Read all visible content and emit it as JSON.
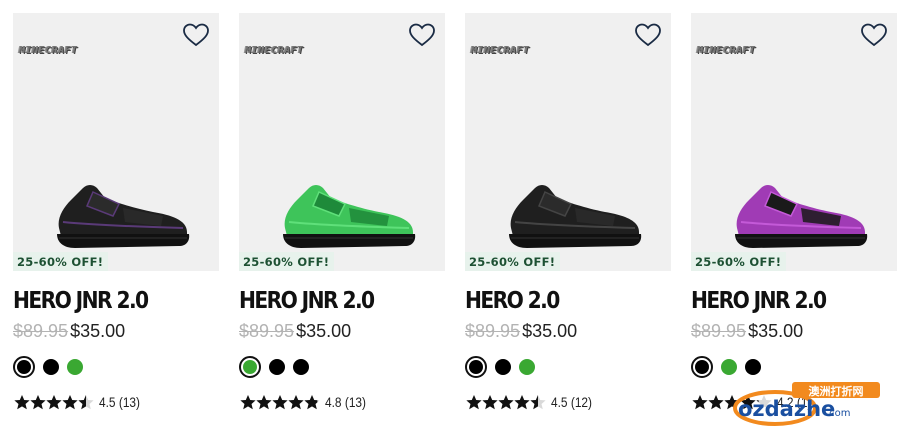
{
  "colors": {
    "accent_green": "#3aa832",
    "badge_bg": "#e7f2ec",
    "badge_text": "#1d5133"
  },
  "products": [
    {
      "brand": "MINECRAFT",
      "wishlist_icon": "heart-outline-icon",
      "badge": "25-60% OFF!",
      "name": "HERO JNR 2.0",
      "was_price": "$89.95",
      "price": "$35.00",
      "shoe": {
        "upper": "#1f1f1f",
        "accent": "#2b2b2b",
        "trim": "#5a3a78"
      },
      "swatches": [
        {
          "color": "#000000",
          "selected": true
        },
        {
          "color": "#000000",
          "selected": false
        },
        {
          "color": "#3aa832",
          "selected": false
        }
      ],
      "rating": "4.5",
      "review_count": "(13)",
      "stars": 4.5
    },
    {
      "brand": "MINECRAFT",
      "wishlist_icon": "heart-outline-icon",
      "badge": "25-60% OFF!",
      "name": "HERO JNR 2.0",
      "was_price": "$89.95",
      "price": "$35.00",
      "shoe": {
        "upper": "#3ec45a",
        "accent": "#1e8a3a",
        "trim": "#5fe07a"
      },
      "swatches": [
        {
          "color": "#3aa832",
          "selected": true
        },
        {
          "color": "#000000",
          "selected": false
        },
        {
          "color": "#000000",
          "selected": false
        }
      ],
      "rating": "4.8",
      "review_count": "(13)",
      "stars": 4.8
    },
    {
      "brand": "MINECRAFT",
      "wishlist_icon": "heart-outline-icon",
      "badge": "25-60% OFF!",
      "name": "HERO 2.0",
      "was_price": "$89.95",
      "price": "$35.00",
      "shoe": {
        "upper": "#1f1f1f",
        "accent": "#2b2b2b",
        "trim": "#444444"
      },
      "swatches": [
        {
          "color": "#000000",
          "selected": true
        },
        {
          "color": "#000000",
          "selected": false
        },
        {
          "color": "#3aa832",
          "selected": false
        }
      ],
      "rating": "4.5",
      "review_count": "(12)",
      "stars": 4.5
    },
    {
      "brand": "MINECRAFT",
      "wishlist_icon": "heart-outline-icon",
      "badge": "25-60% OFF!",
      "name": "HERO JNR 2.0",
      "was_price": "$89.95",
      "price": "$35.00",
      "shoe": {
        "upper": "#a03bb5",
        "accent": "#1a1a1a",
        "trim": "#c45ad8"
      },
      "swatches": [
        {
          "color": "#000000",
          "selected": true
        },
        {
          "color": "#3aa832",
          "selected": false
        },
        {
          "color": "#000000",
          "selected": false
        }
      ],
      "rating": "4.2",
      "review_count": "(1)",
      "stars": 4.2
    }
  ],
  "watermark": {
    "top": "澳洲打折网",
    "main": "ozdazhe",
    "suffix": ".com"
  }
}
